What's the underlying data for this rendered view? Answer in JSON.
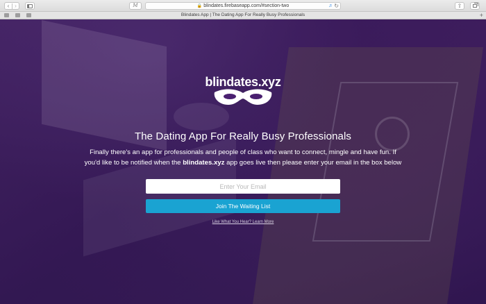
{
  "browser": {
    "url": "blindates.firebaseapp.com/#section-two",
    "tab_title": "Blindates App | The Dating App For Really Busy Professionals",
    "back_icon": "chevron-left-icon",
    "forward_icon": "chevron-right-icon",
    "reader_label": "M"
  },
  "hero": {
    "logo": "blindates.xyz",
    "headline": "The Dating App For Really Busy Professionals",
    "description_before": "Finally there's an app for professionals and people of class who want to connect, mingle and have fun. If you'd like to be notified when the ",
    "description_brand": "blindates.xyz",
    "description_after": " app goes live then please enter your email in the box below",
    "email_placeholder": "Enter Your Email",
    "join_label": "Join The Waiting List",
    "learn_more": "Like What You Hear? Learn More"
  },
  "colors": {
    "overlay": "#3a1460",
    "button": "#1aa3d2",
    "text": "#ffffff"
  }
}
